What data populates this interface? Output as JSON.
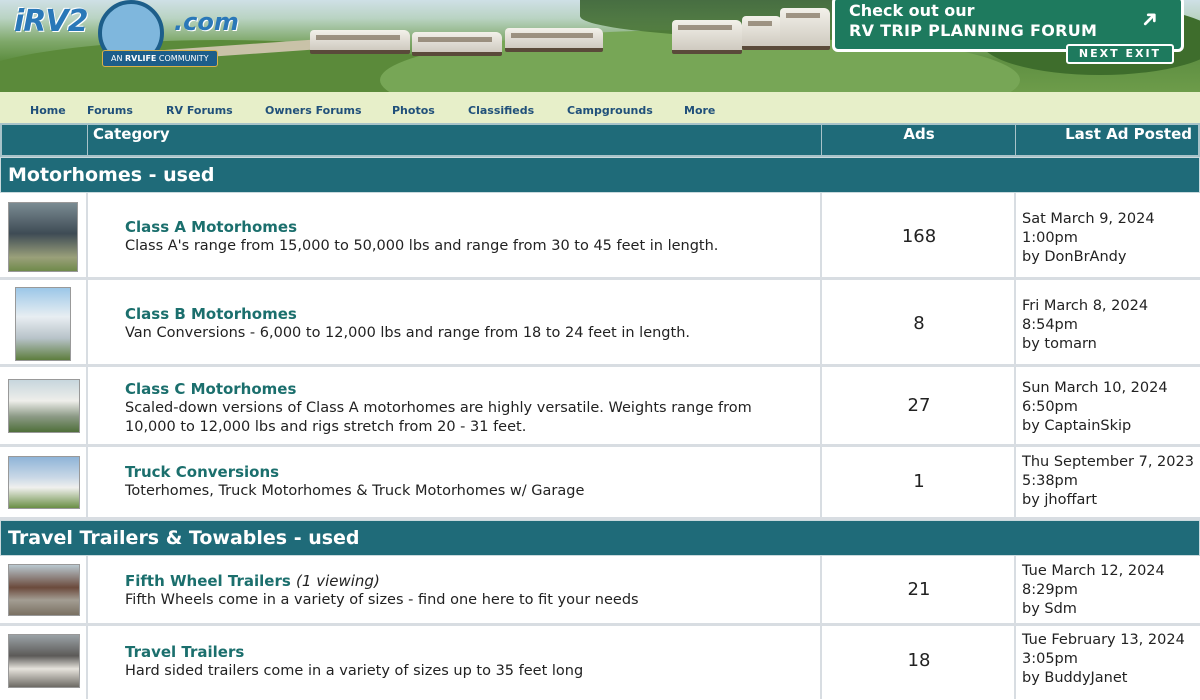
{
  "header": {
    "logo": {
      "brand": "iRV2",
      "domain": ".com",
      "tag_prefix": "AN",
      "tag_brand": "RVLIFE",
      "tag_suffix": "COMMUNITY"
    },
    "promo": {
      "line1": "Check out our",
      "line2": "RV TRIP PLANNING FORUM",
      "exit_label": "NEXT EXIT"
    }
  },
  "nav": {
    "items": [
      "Home",
      "Forums",
      "RV Forums",
      "Owners Forums",
      "Photos",
      "Classifieds",
      "Campgrounds",
      "More"
    ]
  },
  "table": {
    "headers": {
      "category": "Category",
      "ads": "Ads",
      "last_ad": "Last Ad Posted"
    },
    "sections": [
      {
        "title": "Motorhomes - used",
        "rows": [
          {
            "title": "Class A Motorhomes",
            "viewing": "",
            "description": "Class A's range from 15,000 to 50,000 lbs and range from 30 to 45 feet in length.",
            "ads": "168",
            "last_date": "Sat March 9, 2024",
            "last_time": "1:00pm",
            "last_by": "by DonBrAndy"
          },
          {
            "title": "Class B Motorhomes",
            "viewing": "",
            "description": "Van Conversions - 6,000 to 12,000 lbs and range from 18 to 24 feet in length.",
            "ads": "8",
            "last_date": "Fri March 8, 2024",
            "last_time": "8:54pm",
            "last_by": "by tomarn"
          },
          {
            "title": "Class C Motorhomes",
            "viewing": "",
            "description": "Scaled-down versions of Class A motorhomes are highly versatile. Weights range from 10,000 to 12,000 lbs and rigs stretch from 20 - 31 feet.",
            "ads": "27",
            "last_date": "Sun March 10, 2024",
            "last_time": "6:50pm",
            "last_by": "by CaptainSkip"
          },
          {
            "title": "Truck Conversions",
            "viewing": "",
            "description": "Toterhomes, Truck Motorhomes & Truck Motorhomes w/ Garage",
            "ads": "1",
            "last_date": "Thu September 7, 2023 5:38pm",
            "last_time": "",
            "last_by": "by jhoffart"
          }
        ]
      },
      {
        "title": "Travel Trailers & Towables - used",
        "rows": [
          {
            "title": "Fifth Wheel Trailers",
            "viewing": "(1 viewing)",
            "description": "Fifth Wheels come in a variety of sizes - find one here to fit your needs",
            "ads": "21",
            "last_date": "Tue March 12, 2024",
            "last_time": "8:29pm",
            "last_by": "by Sdm"
          },
          {
            "title": "Travel Trailers",
            "viewing": "",
            "description": "Hard sided trailers come in a variety of sizes up to 35 feet long",
            "ads": "18",
            "last_date": "Tue February 13, 2024 3:05pm",
            "last_time": "",
            "last_by": "by BuddyJanet"
          }
        ]
      }
    ]
  },
  "colors": {
    "header_teal": "#1f6b79",
    "link_teal": "#1b6f6d",
    "nav_bg": "#e7efc9",
    "nav_text": "#20507a",
    "promo_green": "#1e7a5e"
  }
}
